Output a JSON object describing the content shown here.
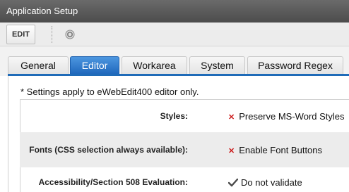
{
  "window": {
    "title": "Application Setup"
  },
  "toolbar": {
    "edit_label": "EDIT",
    "help_icon": "help-circle-icon"
  },
  "tabs": [
    {
      "label": "General",
      "active": false
    },
    {
      "label": "Editor",
      "active": true
    },
    {
      "label": "Workarea",
      "active": false
    },
    {
      "label": "System",
      "active": false
    },
    {
      "label": "Password Regex",
      "active": false
    }
  ],
  "note": "* Settings apply to eWebEdit400 editor only.",
  "settings": [
    {
      "label": "Styles:",
      "value": "Preserve MS-Word Styles",
      "state": "disabled",
      "icon": "x-icon"
    },
    {
      "label": "Fonts (CSS selection always available):",
      "value": "Enable Font Buttons",
      "state": "disabled",
      "icon": "x-icon"
    },
    {
      "label": "Accessibility/Section 508 Evaluation:",
      "value": "Do not validate",
      "state": "enabled",
      "icon": "check-icon"
    }
  ],
  "colors": {
    "active_tab": "#1e66bb",
    "x_mark": "#cc1b1b",
    "titlebar": "#5a5a5a"
  }
}
